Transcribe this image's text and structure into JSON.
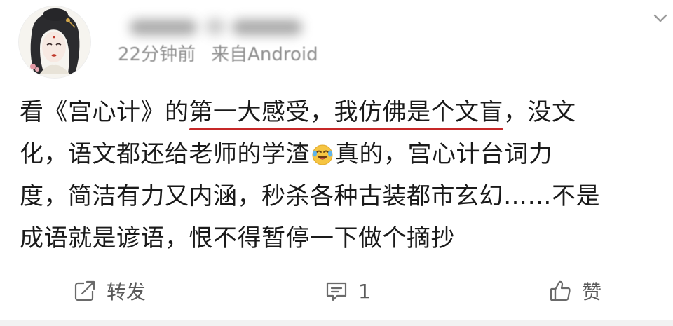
{
  "post": {
    "timestamp": "22分钟前",
    "source": "来自Android",
    "content_lines": [
      {
        "before": "看《宫心计》的",
        "underlined": "第一大感受，我仿佛是个文盲",
        "after": "，没文"
      },
      {
        "before": "化，语文都还给老师的学渣",
        "after": "真的，宫心计台词力"
      },
      {
        "text": "度，简洁有力又内涵，秒杀各种古装都市玄幻……不是"
      },
      {
        "text": "成语就是谚语，恨不得暂停一下做个摘抄"
      }
    ],
    "emoji": "laughing-crying-emoji",
    "colors": {
      "underline": "#c62828",
      "meta_text": "#8e8e8e",
      "action_text": "#5a5a5a"
    }
  },
  "actions": {
    "repost_label": "转发",
    "comment_count": "1",
    "like_label": "赞"
  },
  "icons": {
    "repost": "repost-icon",
    "comment": "comment-icon",
    "like": "thumbs-up-icon",
    "dismiss": "chevron-down-icon"
  }
}
